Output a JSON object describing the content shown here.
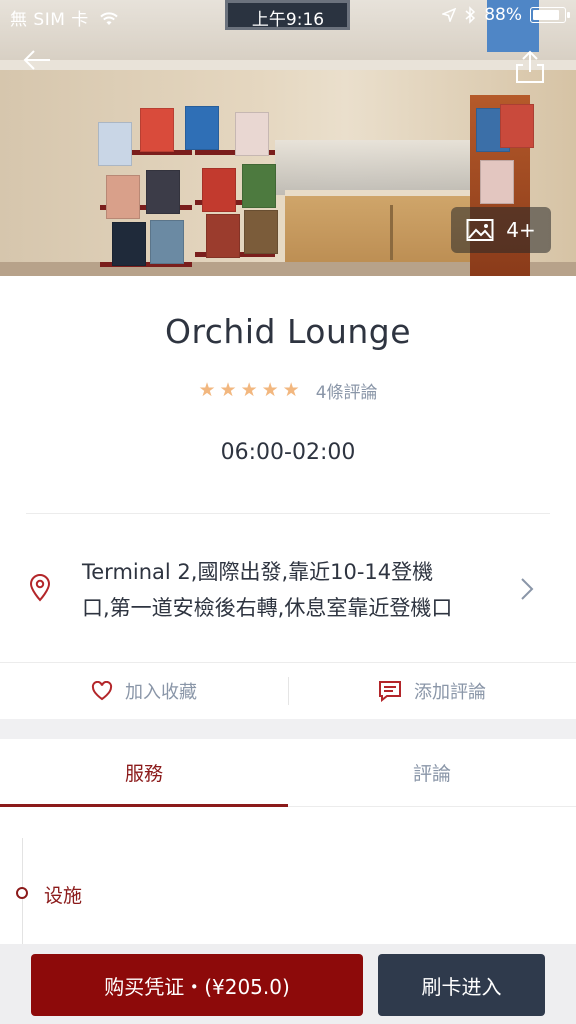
{
  "status_bar": {
    "carrier": "無 SIM 卡",
    "time": "上午9:16",
    "battery": "88%",
    "battery_level": 0.88
  },
  "hero": {
    "photo_count": "4+"
  },
  "lounge": {
    "name": "Orchid Lounge",
    "rating_stars": 5,
    "review_count": "4條評論",
    "hours": "06:00-02:00",
    "address_line1": "Terminal 2,國際出發,靠近10-14登機",
    "address_line2": "口,第一道安檢後右轉,休息室靠近登機口"
  },
  "actions": {
    "favorite": "加入收藏",
    "add_review": "添加評論"
  },
  "tabs": [
    {
      "label": "服務",
      "active": true
    },
    {
      "label": "評論",
      "active": false
    }
  ],
  "services": {
    "facility_label": "设施"
  },
  "bottom_bar": {
    "buy_label": "购买凭证・(¥205.0)",
    "card_label": "刷卡进入"
  },
  "colors": {
    "brand": "#8d0a0a",
    "dark": "#2f3a4c",
    "star": "#f2b77f",
    "muted": "#8a96a8"
  }
}
